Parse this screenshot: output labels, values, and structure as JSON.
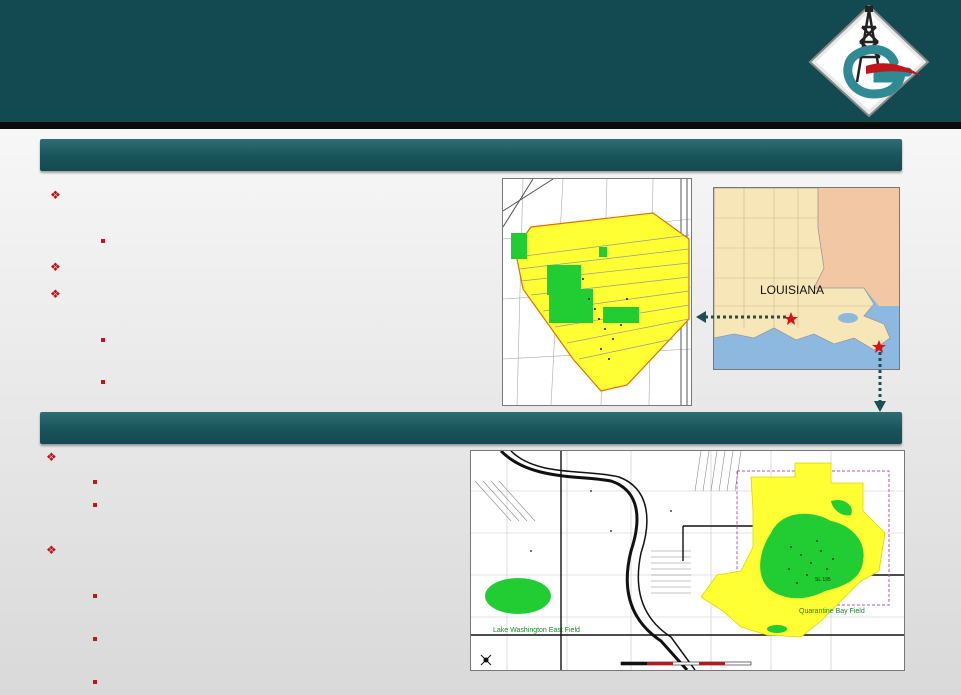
{
  "colors": {
    "header_bg": "#134950",
    "section_bar": "#1a555c",
    "bullet_red": "#c0151a",
    "field_yellow": "#ffff33",
    "field_green": "#22cc33",
    "louisiana_land": "#f6e6b8",
    "neighbor_land": "#f2c7a4",
    "water": "#8db8e0"
  },
  "louisiana_map": {
    "state_label": "LOUISIANA"
  },
  "field_map": {
    "lake_washington_label": "Lake Washington East Field",
    "quarantine_bay_label": "Quarantine Bay Field",
    "sl_label": "SL 195"
  },
  "icons": {
    "diamond_bullet": "diamond-bullet-icon",
    "square_bullet": "square-bullet-icon",
    "star_marker": "star-icon",
    "north_arrow": "north-arrow-icon",
    "logo": "company-logo"
  }
}
